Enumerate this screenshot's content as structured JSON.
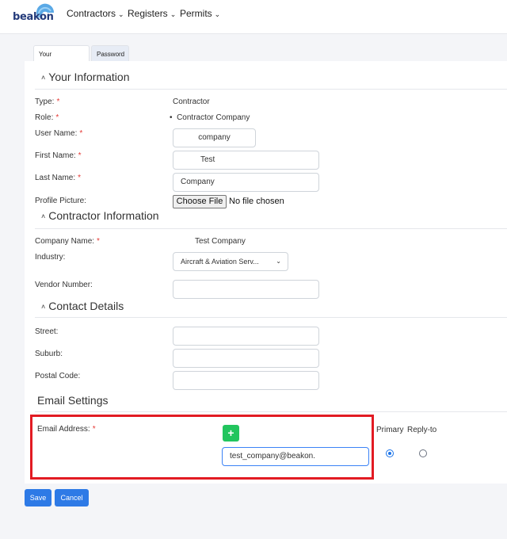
{
  "brand": {
    "name": "beakon"
  },
  "nav": {
    "items": [
      {
        "label": "Contractors"
      },
      {
        "label": "Registers"
      },
      {
        "label": "Permits"
      }
    ]
  },
  "tabs": [
    {
      "label": "Your Information",
      "active": true
    },
    {
      "label": "Password",
      "active": false
    }
  ],
  "sections": {
    "your_info": {
      "title": "Your Information",
      "type_label": "Type:",
      "type_value": "Contractor",
      "role_label": "Role:",
      "role_value": "Contractor Company",
      "username_label": "User Name:",
      "username_value": "company",
      "firstname_label": "First Name:",
      "firstname_value": "Test",
      "lastname_label": "Last Name:",
      "lastname_value": "Company",
      "profile_label": "Profile Picture:",
      "file_button": "Choose File",
      "file_status": "No file chosen"
    },
    "contractor_info": {
      "title": "Contractor Information",
      "company_label": "Company Name:",
      "company_value": "Test Company",
      "industry_label": "Industry:",
      "industry_value": "Aircraft & Aviation Serv...",
      "vendor_label": "Vendor Number:",
      "vendor_value": ""
    },
    "contact": {
      "title": "Contact Details",
      "street_label": "Street:",
      "suburb_label": "Suburb:",
      "postal_label": "Postal Code:"
    },
    "email": {
      "title": "Email Settings",
      "address_label": "Email Address:",
      "add_symbol": "+",
      "address_value": "test_company@beakon.",
      "primary_label": "Primary",
      "replyto_label": "Reply-to",
      "primary_checked": true,
      "replyto_checked": false
    }
  },
  "required_mark": "*",
  "actions": {
    "save": "Save",
    "cancel": "Cancel"
  },
  "colors": {
    "accent": "#2e7ae6",
    "add_button": "#22c55e",
    "highlight": "#e21b23",
    "required": "#e53935"
  }
}
